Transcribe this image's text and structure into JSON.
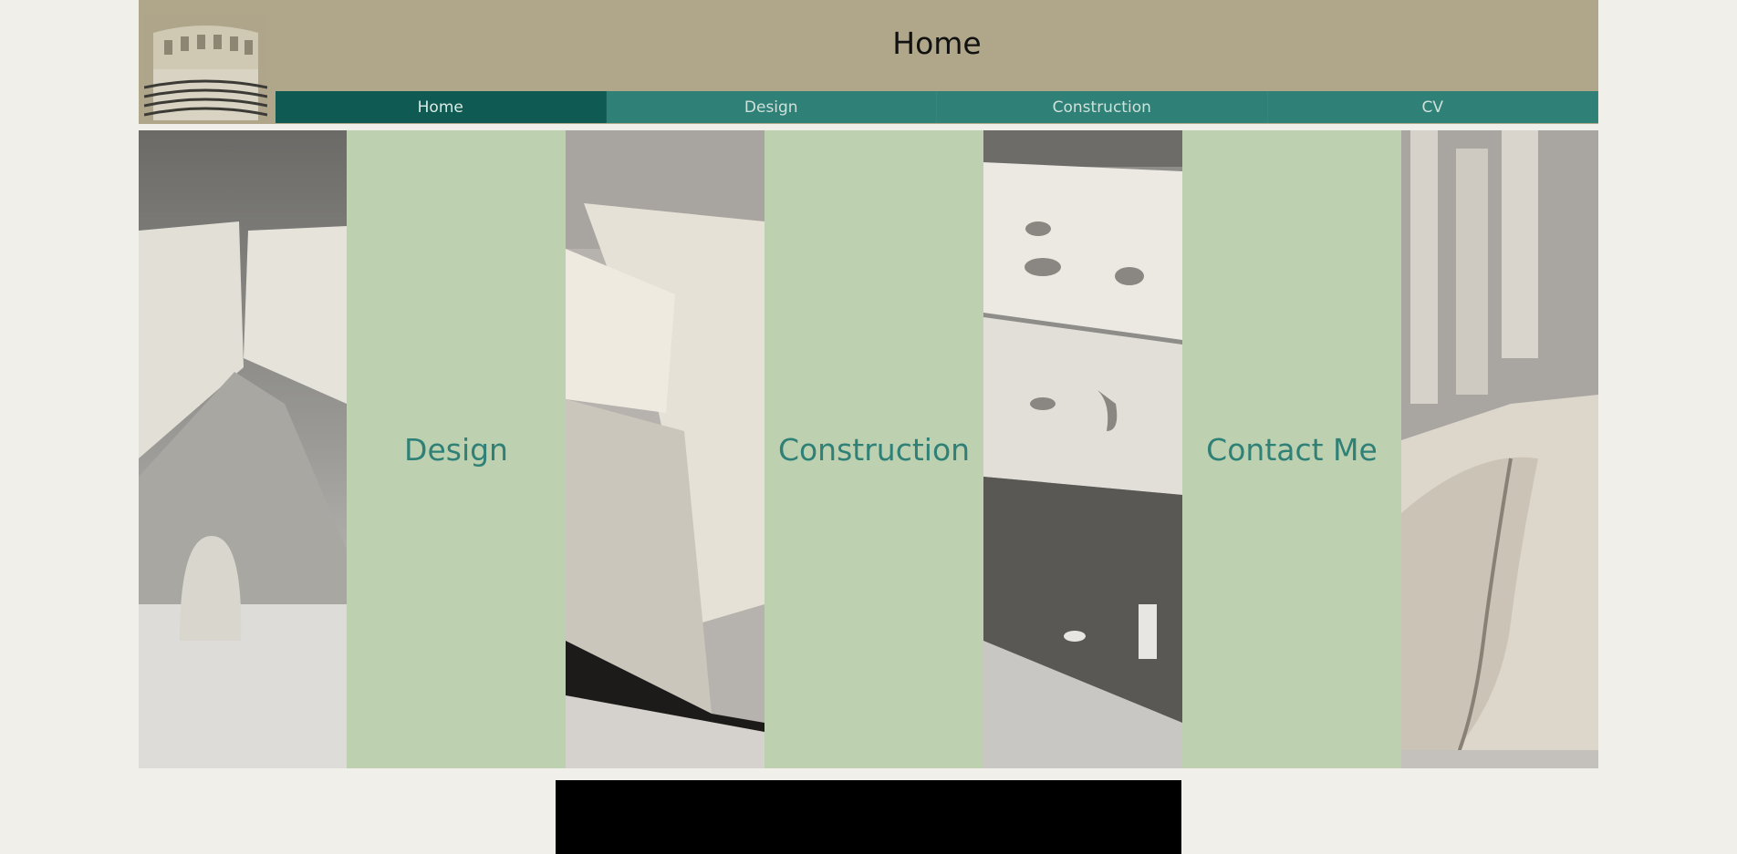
{
  "header": {
    "title": "Home"
  },
  "nav": {
    "items": [
      {
        "label": "Home",
        "active": true
      },
      {
        "label": "Design",
        "active": false
      },
      {
        "label": "Construction",
        "active": false
      },
      {
        "label": "CV",
        "active": false
      }
    ]
  },
  "gallery": {
    "links": [
      {
        "label": "Design"
      },
      {
        "label": "Construction"
      },
      {
        "label": "Contact Me"
      }
    ]
  },
  "colors": {
    "header_bg": "#b0a68a",
    "nav_bg": "#2f8076",
    "nav_active_bg": "#0f5a52",
    "panel_green": "#bdd0b0",
    "link_text": "#2f8076",
    "page_bg": "#f0efea"
  }
}
